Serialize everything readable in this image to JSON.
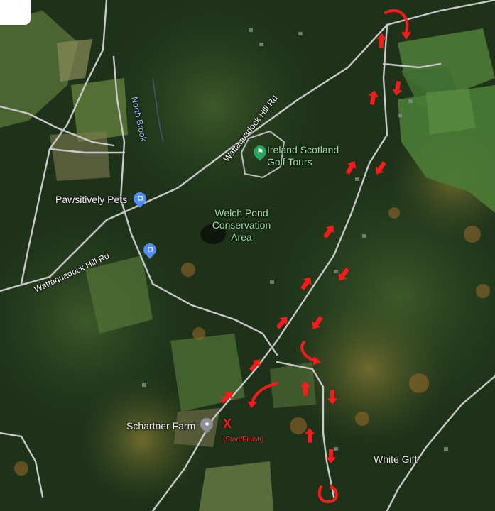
{
  "labels": {
    "north_brook": "North Brook",
    "road_upper": "Wattaquadock Hill Rd",
    "road_lower": "Wattaquadock Hill Rd",
    "pawsitively": "Pawsitively Pets",
    "ireland_line1": "Ireland Scotland",
    "ireland_line2": "Golf Tours",
    "welch_line1": "Welch Pond",
    "welch_line2": "Conservation",
    "welch_line3": "Area",
    "schartner": "Schartner Farm",
    "white_gift": "White Gift",
    "start_mark": "X",
    "start_finish": "(Start/Finish)"
  },
  "icons": {
    "shop_pin": "shopping-bag-icon",
    "golf_pin": "golf-icon",
    "place_pin": "place-pin-icon"
  },
  "colors": {
    "arrow": "#ff1a1a",
    "road": "#c9c9c9",
    "forest": "#1f3a1c",
    "field": "#5f7a3a",
    "shop_pin": "#4f8df5",
    "golf_pin": "#27a35a",
    "place_pin": "#8a9098"
  }
}
